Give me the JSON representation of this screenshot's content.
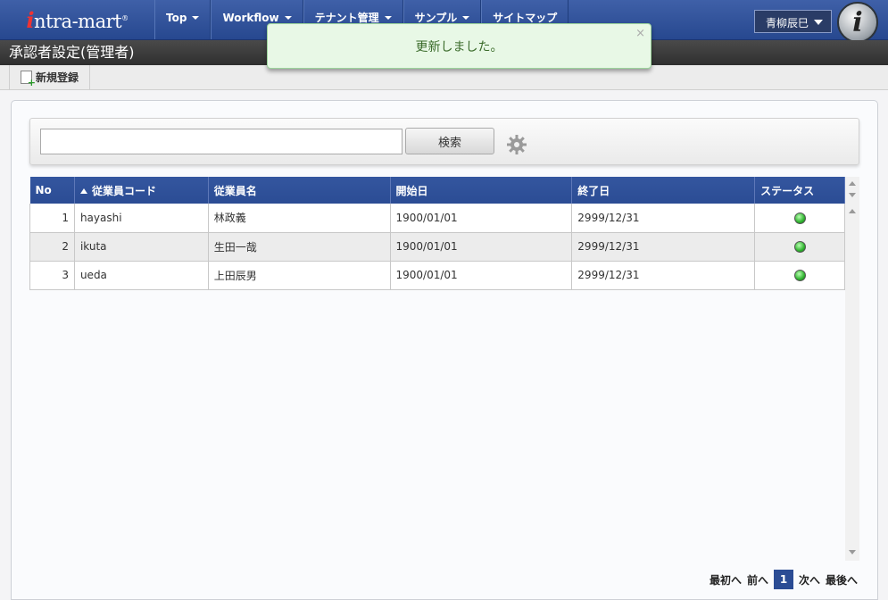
{
  "logo": {
    "i": "i",
    "text": "ntra-mart",
    "reg": "®"
  },
  "nav": [
    {
      "label": "Top",
      "caret": true
    },
    {
      "label": "Workflow",
      "caret": true
    },
    {
      "label": "テナント管理",
      "caret": true
    },
    {
      "label": "サンプル",
      "caret": true
    },
    {
      "label": "サイトマップ",
      "caret": false
    }
  ],
  "user": {
    "name": "青柳辰巳"
  },
  "page_title": "承認者設定(管理者)",
  "toolbar": {
    "new_label": "新規登録"
  },
  "toast": {
    "message": "更新しました。",
    "close": "×"
  },
  "search": {
    "value": "",
    "placeholder": "",
    "button": "検索"
  },
  "grid": {
    "columns": [
      "No",
      "従業員コード",
      "従業員名",
      "開始日",
      "終了日",
      "ステータス"
    ],
    "sort_column": "従業員コード",
    "rows": [
      {
        "no": "1",
        "code": "hayashi",
        "name": "林政義",
        "start": "1900/01/01",
        "end": "2999/12/31",
        "status": "active"
      },
      {
        "no": "2",
        "code": "ikuta",
        "name": "生田一哉",
        "start": "1900/01/01",
        "end": "2999/12/31",
        "status": "active"
      },
      {
        "no": "3",
        "code": "ueda",
        "name": "上田辰男",
        "start": "1900/01/01",
        "end": "2999/12/31",
        "status": "active"
      }
    ]
  },
  "pager": {
    "first": "最初へ",
    "prev": "前へ",
    "current": "1",
    "next": "次へ",
    "last": "最後へ"
  },
  "colors": {
    "nav_bg": "#2f50a0",
    "header_bg": "#2b4c94",
    "toast_bg": "#e8f8e6",
    "status_active": "#2fb22f"
  }
}
